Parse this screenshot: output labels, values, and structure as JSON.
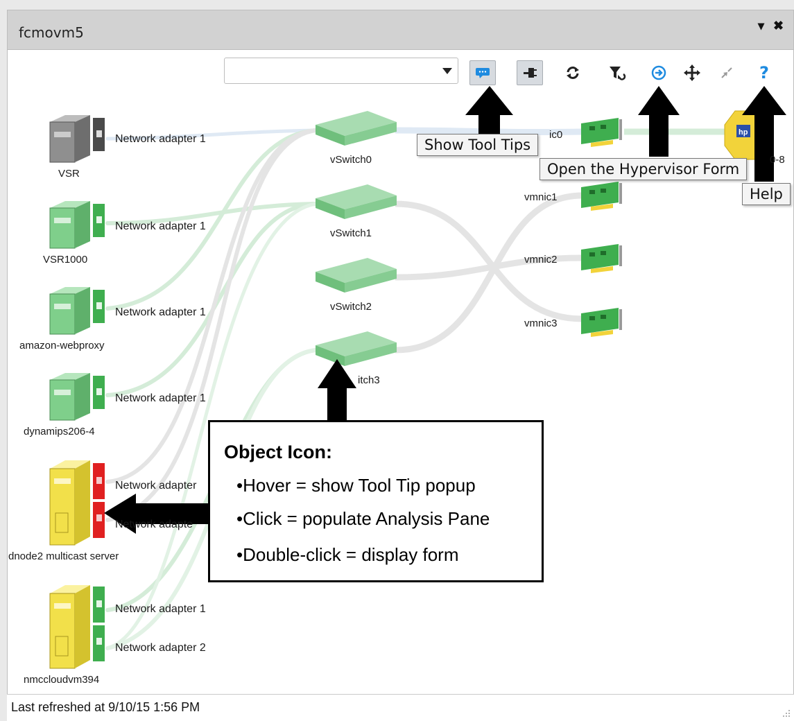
{
  "window": {
    "title": "fcmovm5",
    "menu_icon": "dropdown-caret-icon",
    "close_icon": "close-icon"
  },
  "toolbar": {
    "search": {
      "value": "",
      "placeholder": ""
    },
    "buttons": [
      {
        "name": "tooltips-toggle",
        "icon": "speech-bubble-icon",
        "pressed": true
      },
      {
        "name": "plug-toggle",
        "icon": "plug-icon",
        "pressed": true
      },
      {
        "name": "refresh",
        "icon": "refresh-icon"
      },
      {
        "name": "filter",
        "icon": "filter-icon"
      },
      {
        "name": "open-hypervisor",
        "icon": "arrow-circle-icon"
      },
      {
        "name": "move",
        "icon": "move-icon"
      },
      {
        "name": "collapse",
        "icon": "collapse-icon"
      },
      {
        "name": "help",
        "icon": "help-icon",
        "glyph": "?"
      }
    ]
  },
  "vms": [
    {
      "name": "VSR",
      "color": "#8f8f8f",
      "adapters": [
        "Network adapter 1"
      ]
    },
    {
      "name": "VSR1000",
      "color": "#7fcf8b",
      "adapters": [
        "Network adapter 1"
      ]
    },
    {
      "name": "amazon-webproxy",
      "color": "#7fcf8b",
      "adapters": [
        "Network adapter 1"
      ]
    },
    {
      "name": "dynamips206-4",
      "color": "#7fcf8b",
      "adapters": [
        "Network adapter 1"
      ]
    },
    {
      "name": "dnode2 multicast server",
      "color": "#f2e04a",
      "adapters": [
        "Network adapter",
        "Network adapte"
      ]
    },
    {
      "name": "nmccloudvm394",
      "color": "#f2e04a",
      "adapters": [
        "Network adapter 1",
        "Network adapter 2"
      ]
    }
  ],
  "switches": [
    "vSwitch0",
    "vSwitch1",
    "vSwitch2",
    "itch3"
  ],
  "nics": [
    "ic0",
    "vmnic1",
    "vmnic2",
    "vmnic3"
  ],
  "host": {
    "label_fragment": "0-8",
    "badge": "hp"
  },
  "tooltips": {
    "show_tool_tips": "Show Tool Tips",
    "open_hypervisor": "Open the Hypervisor Form",
    "help": "Help"
  },
  "callout": {
    "title": "Object Icon:",
    "items": [
      "Hover = show Tool Tip popup",
      "Click = populate Analysis Pane",
      "Double-click = display form"
    ]
  },
  "status": {
    "text": "Last refreshed at 9/10/15 1:56 PM"
  },
  "colors": {
    "link_green": "#d4ecd8",
    "link_grey": "#e4e4e4",
    "link_blue": "#dfe9f4",
    "switch_green": "#8fd39b",
    "accent_blue": "#1e8be0",
    "alert_red": "#e02020"
  }
}
